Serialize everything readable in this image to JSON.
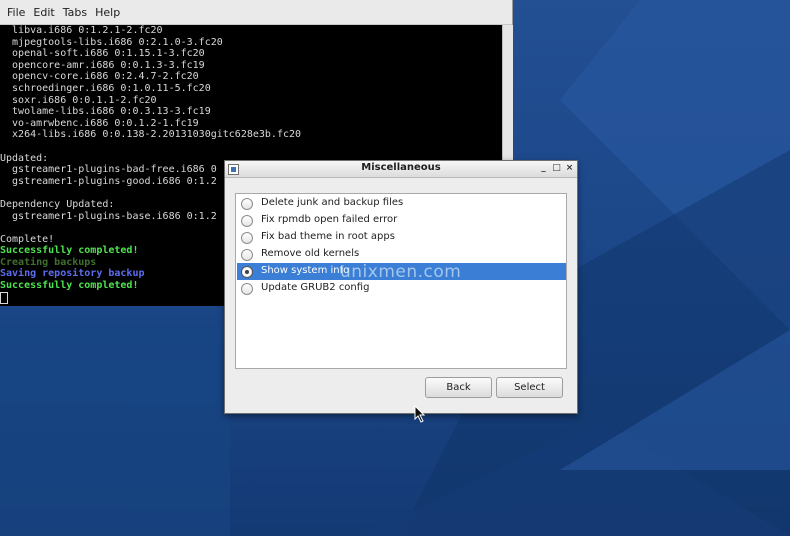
{
  "terminal": {
    "menu": [
      "File",
      "Edit",
      "Tabs",
      "Help"
    ],
    "lines": [
      {
        "text": "  libva.i686 0:1.2.1-2.fc20",
        "style": "normal"
      },
      {
        "text": "  mjpegtools-libs.i686 0:2.1.0-3.fc20",
        "style": "normal"
      },
      {
        "text": "  openal-soft.i686 0:1.15.1-3.fc20",
        "style": "normal"
      },
      {
        "text": "  opencore-amr.i686 0:0.1.3-3.fc19",
        "style": "normal"
      },
      {
        "text": "  opencv-core.i686 0:2.4.7-2.fc20",
        "style": "normal"
      },
      {
        "text": "  schroedinger.i686 0:1.0.11-5.fc20",
        "style": "normal"
      },
      {
        "text": "  soxr.i686 0:0.1.1-2.fc20",
        "style": "normal"
      },
      {
        "text": "  twolame-libs.i686 0:0.3.13-3.fc19",
        "style": "normal"
      },
      {
        "text": "  vo-amrwbenc.i686 0:0.1.2-1.fc19",
        "style": "normal"
      },
      {
        "text": "  x264-libs.i686 0:0.138-2.20131030gitc628e3b.fc20",
        "style": "normal"
      },
      {
        "text": "",
        "style": "normal"
      },
      {
        "text": "Updated:",
        "style": "normal"
      },
      {
        "text": "  gstreamer1-plugins-bad-free.i686 0",
        "style": "normal"
      },
      {
        "text": "  gstreamer1-plugins-good.i686 0:1.2",
        "style": "normal"
      },
      {
        "text": "",
        "style": "normal"
      },
      {
        "text": "Dependency Updated:",
        "style": "normal"
      },
      {
        "text": "  gstreamer1-plugins-base.i686 0:1.2",
        "style": "normal"
      },
      {
        "text": "",
        "style": "normal"
      },
      {
        "text": "Complete!",
        "style": "normal"
      },
      {
        "text": "Successfully completed!",
        "style": "green"
      },
      {
        "text": "Creating backups",
        "style": "dim"
      },
      {
        "text": "Saving repository backup",
        "style": "blue"
      },
      {
        "text": "Successfully completed!",
        "style": "green"
      }
    ]
  },
  "dialog": {
    "title": "Miscellaneous",
    "controls": {
      "minimize": "_",
      "maximize": "□",
      "close": "×"
    },
    "options": [
      {
        "label": "Delete junk and backup files",
        "selected": false
      },
      {
        "label": "Fix rpmdb open failed error",
        "selected": false
      },
      {
        "label": "Fix bad theme in root apps",
        "selected": false
      },
      {
        "label": "Remove old kernels",
        "selected": false
      },
      {
        "label": "Show system info",
        "selected": true
      },
      {
        "label": "Update GRUB2 config",
        "selected": false
      }
    ],
    "back_label": "Back",
    "select_label": "Select"
  },
  "watermark": "unixmen.com",
  "colors": {
    "selection": "#3a7fd5",
    "desktop": "#1d4a8c",
    "terminal_green": "#4fe34f",
    "terminal_blue": "#5d6df0"
  }
}
